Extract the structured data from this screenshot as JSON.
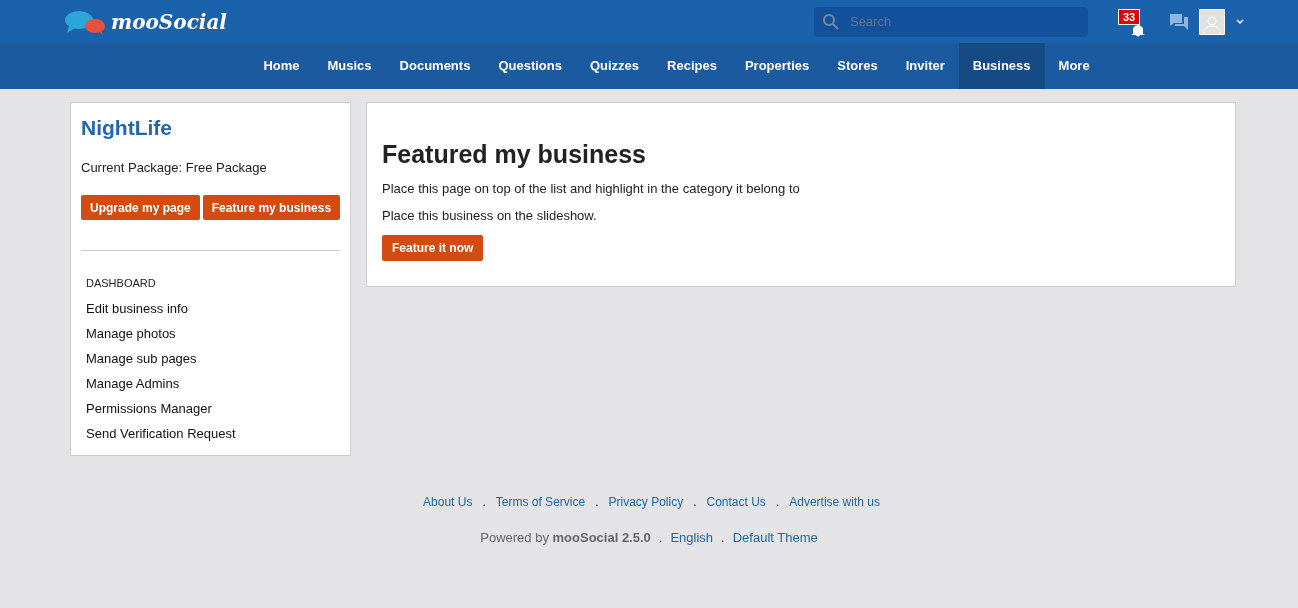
{
  "header": {
    "logo": "mooSocial",
    "search": {
      "placeholder": "Search"
    },
    "notification_count": "33"
  },
  "nav": [
    {
      "label": "Home",
      "selected": false
    },
    {
      "label": "Musics",
      "selected": false
    },
    {
      "label": "Documents",
      "selected": false
    },
    {
      "label": "Questions",
      "selected": false
    },
    {
      "label": "Quizzes",
      "selected": false
    },
    {
      "label": "Recipes",
      "selected": false
    },
    {
      "label": "Properties",
      "selected": false
    },
    {
      "label": "Stores",
      "selected": false
    },
    {
      "label": "Inviter",
      "selected": false
    },
    {
      "label": "Business",
      "selected": true
    },
    {
      "label": "More",
      "selected": false
    }
  ],
  "sidebar": {
    "title": "NightLife",
    "package": "Current Package: Free Package",
    "buttons": [
      "Upgrade my page",
      "Feature my business"
    ],
    "section": "DASHBOARD",
    "items": [
      "Edit business info",
      "Manage photos",
      "Manage sub pages",
      "Manage Admins",
      "Permissions Manager",
      "Send Verification Request"
    ]
  },
  "main": {
    "title": "Featured my business",
    "lines": [
      "Place this page on top of the list and highlight in the category it belong to",
      "Place this business on the slideshow."
    ],
    "button": "Feature it now"
  },
  "footer": {
    "links": [
      {
        "label": "About Us"
      },
      {
        "sep": ".",
        "label": "Terms of Service"
      },
      {
        "sep": ".",
        "label": "Privacy Policy"
      },
      {
        "sep": ".",
        "label": "Contact Us"
      },
      {
        "sep": ".",
        "label": "Advertise with us"
      }
    ],
    "powered": "Powered by **mooSocial 2.5.0**",
    "bottom_links": [
      {
        "sep": ".",
        "label": "English"
      },
      {
        "sep": ".",
        "label": "Default Theme"
      }
    ]
  }
}
